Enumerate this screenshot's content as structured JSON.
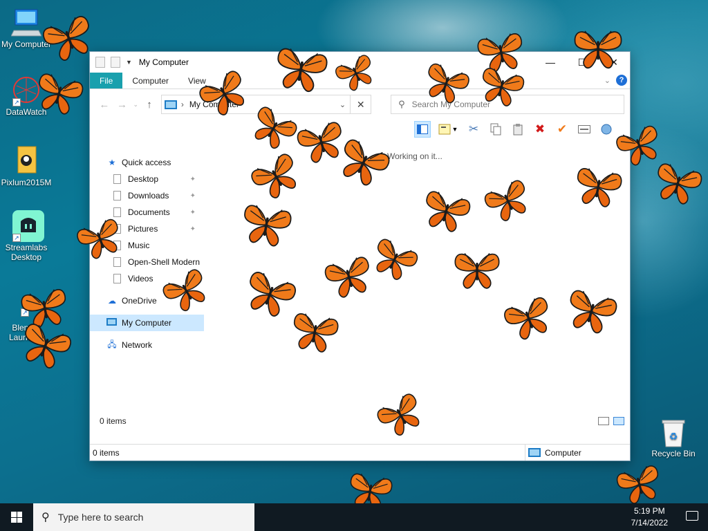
{
  "desktop": {
    "icons": [
      {
        "label": "My Computer"
      },
      {
        "label": "DataWatch"
      },
      {
        "label": "Pixlum2015M"
      },
      {
        "label": "Streamlabs Desktop"
      },
      {
        "label": "Blender Launcher"
      },
      {
        "label": "Recycle Bin"
      }
    ]
  },
  "window": {
    "title": "My Computer",
    "tabs": [
      "File",
      "Computer",
      "View"
    ],
    "address": "My Computer",
    "search_placeholder": "Search My Computer",
    "status_text": "Working on it...",
    "nav": {
      "quick_access": "Quick access",
      "items": [
        "Desktop",
        "Downloads",
        "Documents",
        "Pictures",
        "Music",
        "Open-Shell Modern",
        "Videos"
      ],
      "onedrive": "OneDrive",
      "my_computer": "My Computer",
      "network": "Network"
    },
    "item_count": "0 items",
    "statusbar": {
      "left": "0 items",
      "right": "Computer"
    }
  },
  "taskbar": {
    "search_placeholder": "Type here to search",
    "time": "5:19 PM",
    "date": "7/14/2022"
  },
  "colors": {
    "file_tab": "#19a0ad",
    "butterfly": "#f07a1a",
    "taskbar": "#101a22"
  }
}
